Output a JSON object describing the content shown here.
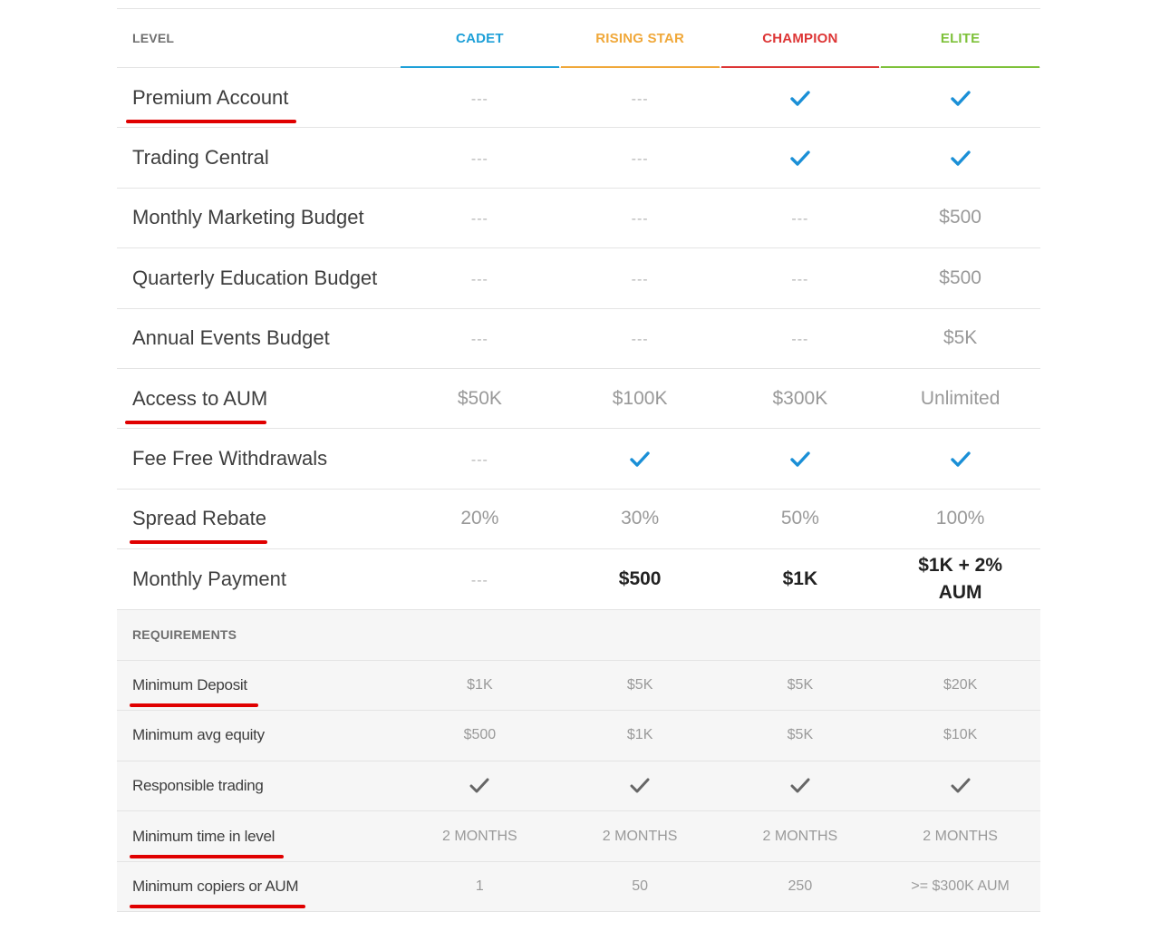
{
  "header": {
    "level_label": "LEVEL",
    "tiers": [
      {
        "name": "CADET",
        "color": "#1ea0d8"
      },
      {
        "name": "RISING STAR",
        "color": "#f0a83a"
      },
      {
        "name": "CHAMPION",
        "color": "#dd3535"
      },
      {
        "name": "ELITE",
        "color": "#7ec13a"
      }
    ]
  },
  "features": [
    {
      "label": "Premium Account",
      "values": [
        "---",
        "---",
        "check",
        "check"
      ]
    },
    {
      "label": "Trading Central",
      "values": [
        "---",
        "---",
        "check",
        "check"
      ]
    },
    {
      "label": "Monthly Marketing Budget",
      "values": [
        "---",
        "---",
        "---",
        "$500"
      ]
    },
    {
      "label": "Quarterly Education Budget",
      "values": [
        "---",
        "---",
        "---",
        "$500"
      ]
    },
    {
      "label": "Annual Events Budget",
      "values": [
        "---",
        "---",
        "---",
        "$5K"
      ]
    },
    {
      "label": "Access to AUM",
      "values": [
        "$50K",
        "$100K",
        "$300K",
        "Unlimited"
      ]
    },
    {
      "label": "Fee Free Withdrawals",
      "values": [
        "---",
        "check",
        "check",
        "check"
      ]
    },
    {
      "label": "Spread Rebate",
      "values": [
        "20%",
        "30%",
        "50%",
        "100%"
      ]
    },
    {
      "label": "Monthly Payment",
      "values": [
        "---",
        "$500",
        "$1K",
        "$1K + 2% AUM"
      ]
    }
  ],
  "requirements": {
    "section_label": "REQUIREMENTS",
    "rows": [
      {
        "label": "Minimum Deposit",
        "values": [
          "$1K",
          "$5K",
          "$5K",
          "$20K"
        ]
      },
      {
        "label": "Minimum avg equity",
        "values": [
          "$500",
          "$1K",
          "$5K",
          "$10K"
        ]
      },
      {
        "label": "Responsible trading",
        "values": [
          "check",
          "check",
          "check",
          "check"
        ]
      },
      {
        "label": "Minimum time in level",
        "values": [
          "2 MONTHS",
          "2 MONTHS",
          "2 MONTHS",
          "2 MONTHS"
        ]
      },
      {
        "label": "Minimum copiers or AUM",
        "values": [
          "1",
          "50",
          "250",
          ">= $300K AUM"
        ]
      }
    ]
  },
  "colors": {
    "check_blue": "#1a8fd6",
    "check_gray": "#666666",
    "annotation_red": "#e00000"
  },
  "icons": {
    "check": "check-icon"
  }
}
